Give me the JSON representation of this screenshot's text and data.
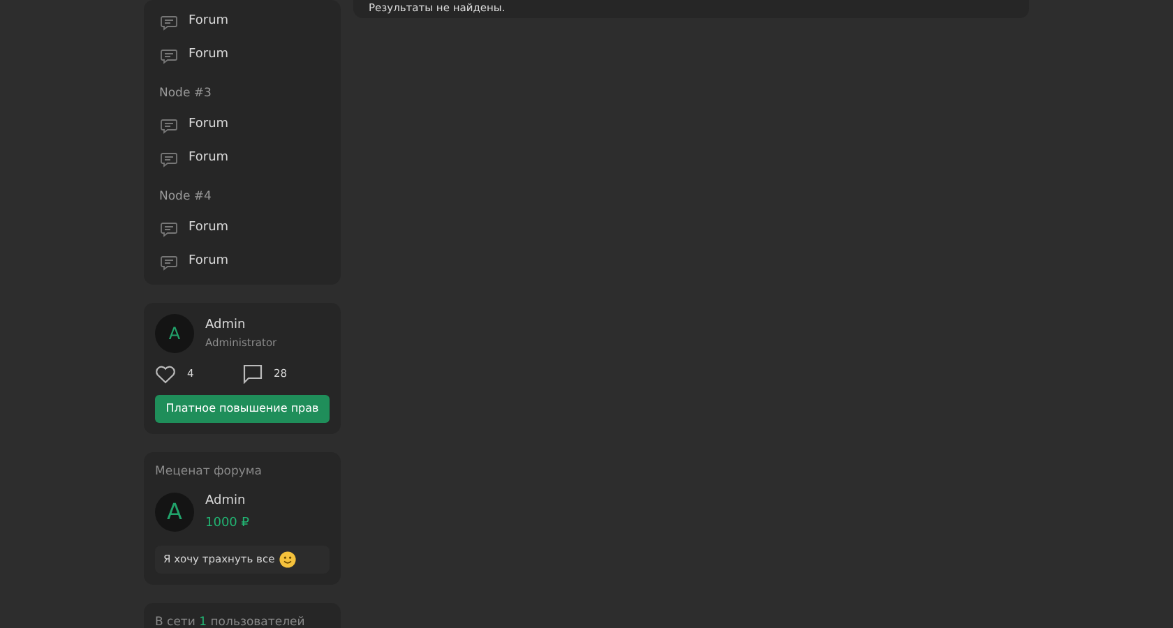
{
  "search_results": {
    "message": "Результаты не найдены."
  },
  "forum_list": [
    {
      "kind": "forum",
      "label": "Forum"
    },
    {
      "kind": "forum",
      "label": "Forum"
    },
    {
      "kind": "node",
      "label": "Node #3"
    },
    {
      "kind": "forum",
      "label": "Forum"
    },
    {
      "kind": "forum",
      "label": "Forum"
    },
    {
      "kind": "node",
      "label": "Node #4"
    },
    {
      "kind": "forum",
      "label": "Forum"
    },
    {
      "kind": "forum",
      "label": "Forum"
    }
  ],
  "user_card": {
    "avatar_letter": "A",
    "name": "Admin",
    "role": "Administrator",
    "likes": "4",
    "messages": "28",
    "button": "Платное повышение прав"
  },
  "patron": {
    "title": "Меценат форума",
    "avatar_letter": "A",
    "name": "Admin",
    "amount": "1000 ₽",
    "message": "Я хочу трахнуть все"
  },
  "online": {
    "prefix": "В сети",
    "count": "1",
    "suffix": "пользователей"
  }
}
